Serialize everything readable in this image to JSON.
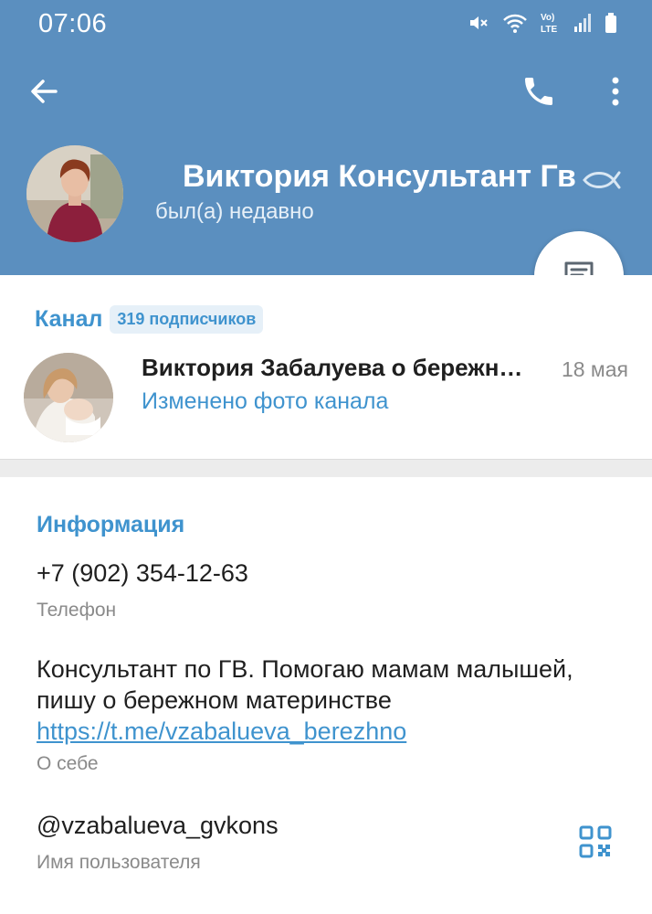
{
  "status_bar": {
    "time": "07:06",
    "icons": [
      "mute-icon",
      "wifi-icon",
      "volte-icon",
      "signal-icon",
      "battery-icon"
    ]
  },
  "toolbar": {
    "back_icon": "arrow-left-icon",
    "call_icon": "phone-icon",
    "more_icon": "more-vertical-icon"
  },
  "profile": {
    "name": "Виктория Консультант Гв",
    "status": "был(а) недавно",
    "emoji_icon": "fish-icon"
  },
  "channel": {
    "label": "Канал",
    "subscribers": "319 подписчиков",
    "title": "Виктория Забалуева о бережном материнстве",
    "date": "18 мая",
    "message": "Изменено фото канала"
  },
  "info": {
    "title": "Информация",
    "phone": "+7 (902) 354-12-63",
    "phone_label": "Телефон",
    "bio_line1": "Консультант по ГВ. Помогаю мамам малышей,",
    "bio_line2": "пишу о бережном материнстве",
    "bio_link": "https://t.me/vzabalueva_berezhno",
    "bio_label": "О себе",
    "username": "@vzabalueva_gvkons",
    "username_label": "Имя пользователя"
  },
  "colors": {
    "header_bg": "#5b8fbf",
    "accent": "#3f93ce",
    "secondary_text": "#8a8a8a"
  }
}
